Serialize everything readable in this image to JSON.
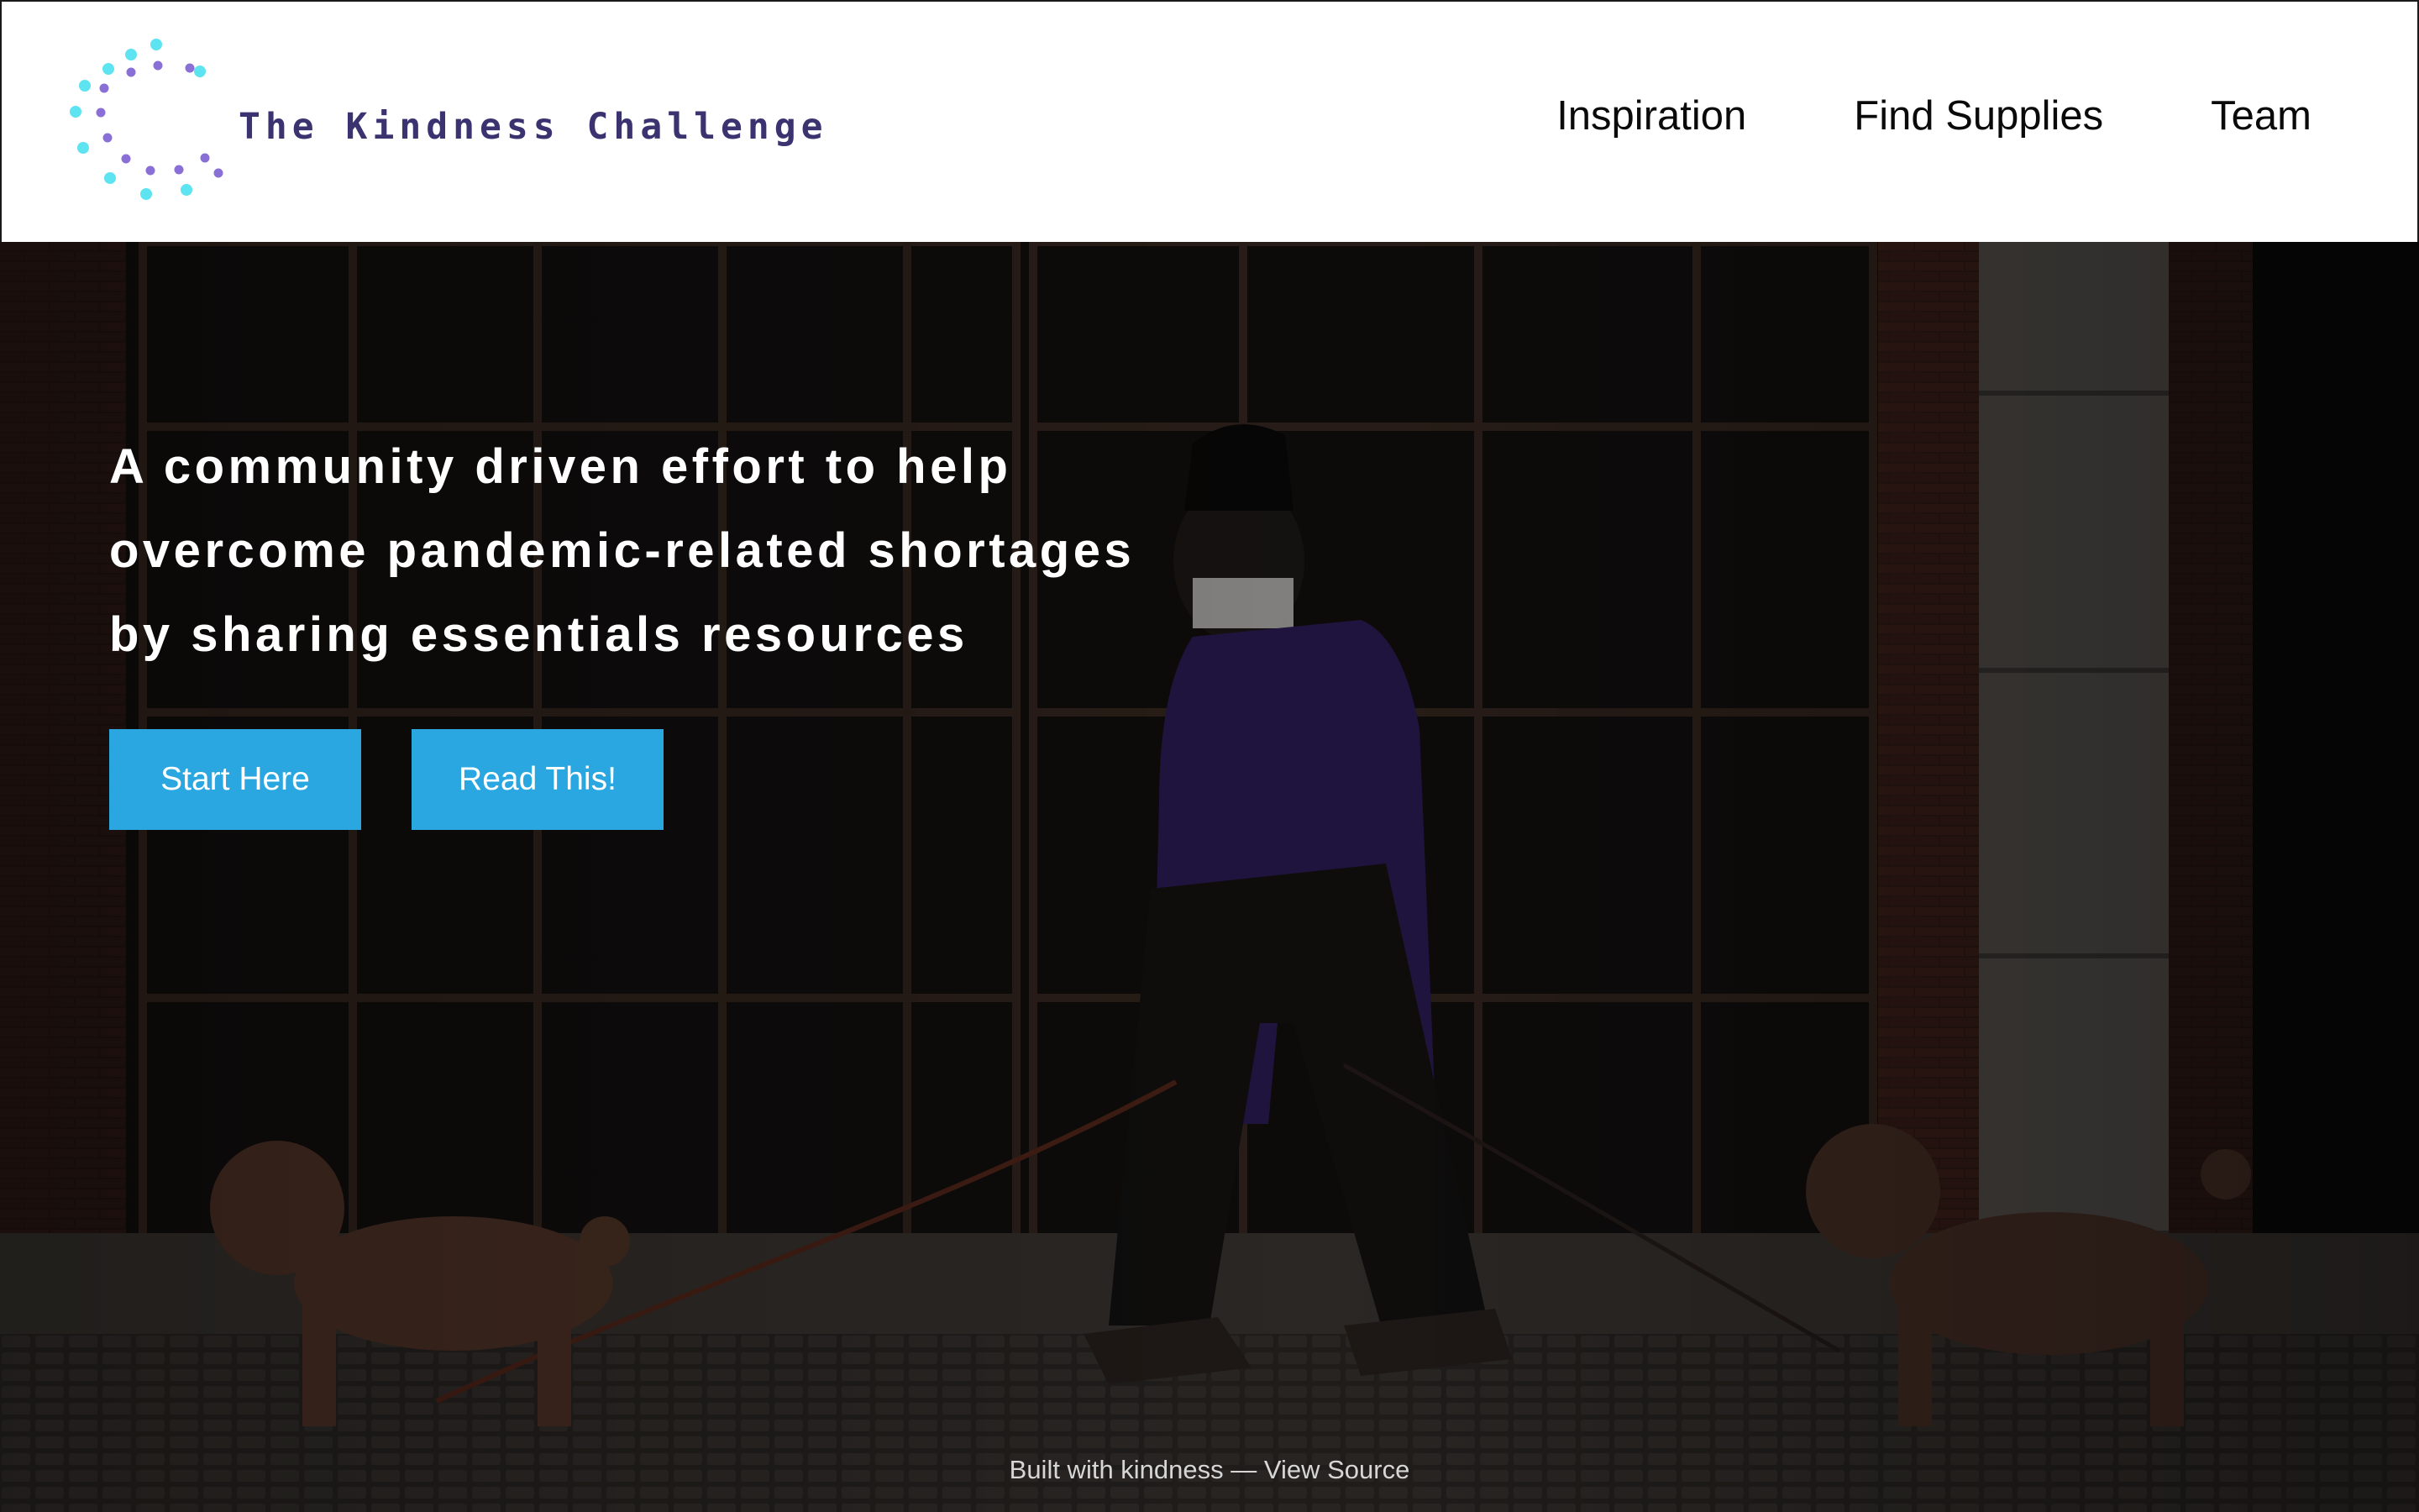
{
  "header": {
    "brand_name": "The Kindness Challenge",
    "nav": [
      {
        "label": "Inspiration"
      },
      {
        "label": "Find Supplies"
      },
      {
        "label": "Team"
      }
    ]
  },
  "hero": {
    "headline_lines": [
      "A community driven effort to help",
      "overcome pandemic-related shortages",
      "by sharing essentials resources"
    ],
    "buttons": [
      {
        "label": "Start Here"
      },
      {
        "label": "Read This!"
      }
    ]
  },
  "footer": {
    "built_text": "Built with kindness",
    "separator": " —  ",
    "source_link": "View Source"
  },
  "colors": {
    "accent_button": "#2aa7e1",
    "logo_cyan": "#5ee3f0",
    "logo_purple": "#8a6fd6",
    "brand_text": "#3b3270"
  },
  "icons": {
    "logo": "dotted-c-logo-icon"
  }
}
